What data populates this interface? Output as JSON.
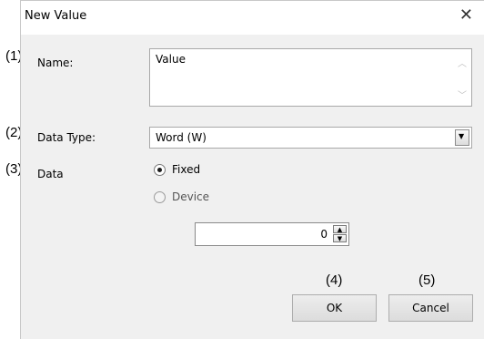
{
  "dialog": {
    "title": "New Value",
    "close_glyph": "✕"
  },
  "callouts": {
    "name": "(1)",
    "data_type": "(2)",
    "data": "(3)",
    "ok": "(4)",
    "cancel": "(5)"
  },
  "fields": {
    "name": {
      "label": "Name:",
      "value": "Value"
    },
    "data_type": {
      "label": "Data Type:",
      "value": "Word (W)"
    },
    "data": {
      "label": "Data",
      "options": [
        {
          "label": "Fixed",
          "selected": true
        },
        {
          "label": "Device",
          "selected": false
        }
      ],
      "fixed_value": "0"
    }
  },
  "buttons": {
    "ok": "OK",
    "cancel": "Cancel"
  },
  "icons": {
    "scroll_up": "chevron-up-icon",
    "scroll_down": "chevron-down-icon",
    "dropdown": "dropdown-arrow-icon",
    "close": "close-icon"
  }
}
